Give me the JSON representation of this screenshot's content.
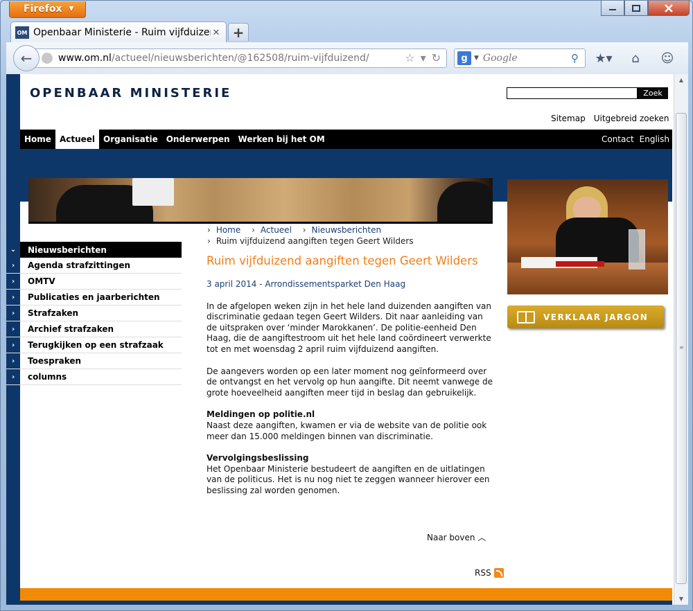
{
  "browser": {
    "menu_label": "Firefox",
    "tab_title": "Openbaar Ministerie - Ruim vijfduizend ...",
    "url_host": "www.om.nl",
    "url_path": "/actueel/nieuwsberichten/@162508/ruim-vijfduizend/",
    "search_placeholder": "Google",
    "favicon_text": "OM"
  },
  "site": {
    "logo": "OPENBAAR MINISTERIE",
    "search_button": "Zoek",
    "top_links": [
      "Sitemap",
      "Uitgebreid zoeken"
    ],
    "nav": [
      "Home",
      "Actueel",
      "Organisatie",
      "Onderwerpen",
      "Werken bij het OM"
    ],
    "nav_active": "Actueel",
    "nav_right": [
      "Contact",
      "English"
    ]
  },
  "breadcrumb": {
    "items": [
      "Home",
      "Actueel",
      "Nieuwsberichten"
    ],
    "current": "Ruim vijfduizend aangiften tegen Geert Wilders"
  },
  "sidebar": {
    "items": [
      "Nieuwsberichten",
      "Agenda strafzittingen",
      "OMTV",
      "Publicaties en jaarberichten",
      "Strafzaken",
      "Archief strafzaken",
      "Terugkijken op een strafzaak",
      "Toespraken",
      "columns"
    ]
  },
  "article": {
    "title": "Ruim vijfduizend aangiften tegen Geert Wilders",
    "meta": "3 april 2014 - Arrondissementsparket Den Haag",
    "p1": "In de afgelopen weken zijn in het hele land duizenden aangiften van discriminatie gedaan tegen Geert Wilders. Dit naar aanleiding van de uitspraken over ‘minder Marokkanen’. De politie-eenheid Den Haag, die de aangiftestroom uit het hele land coördineert verwerkte tot en met woensdag 2 april ruim vijfduizend aangiften.",
    "p2": "De aangevers worden op een later moment nog geïnformeerd over de ontvangst en het vervolg op hun aangifte. Dit neemt vanwege de grote hoeveelheid aangiften meer tijd in beslag dan gebruikelijk.",
    "h1": "Meldingen op politie.nl",
    "p3": "Naast deze aangiften, kwamen er via de website van de politie ook meer dan 15.000 meldingen binnen van discriminatie.",
    "h2": "Vervolgingsbeslissing",
    "p4": "Het Openbaar Ministerie bestudeert de aangiften en de uitlatingen van de politicus. Het is nu nog niet te zeggen wanneer hierover een beslissing zal worden genomen."
  },
  "back_to_top": "Naar boven",
  "rss": "RSS",
  "jargon_button": "VERKLAAR JARGON",
  "colors": {
    "navy": "#0e3769",
    "orange": "#f28a05",
    "title_orange": "#f07e1a",
    "gold": "#c99a1c"
  }
}
